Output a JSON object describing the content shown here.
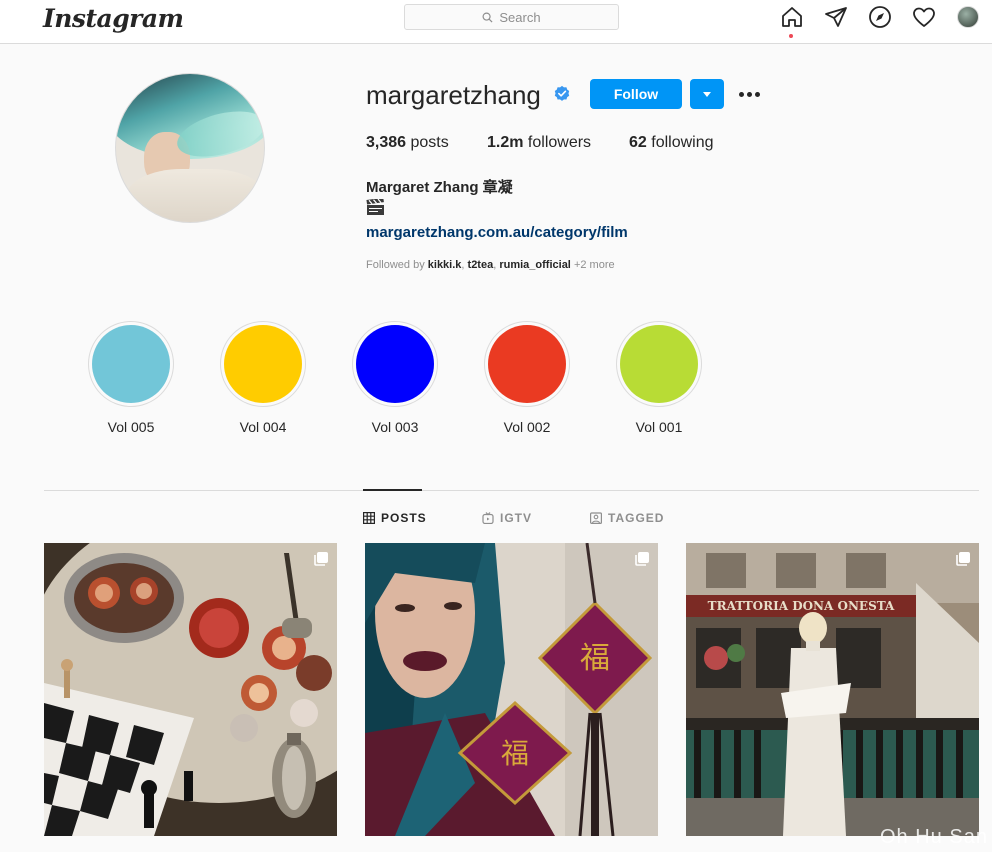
{
  "nav": {
    "logo": "Instagram",
    "search_placeholder": "Search",
    "icons": [
      "home-icon",
      "direct-icon",
      "explore-icon",
      "activity-icon",
      "profile-avatar"
    ]
  },
  "profile": {
    "username": "margaretzhang",
    "verified": true,
    "follow_label": "Follow",
    "stats": {
      "posts_count": "3,386",
      "posts_label": "posts",
      "followers_count": "1.2m",
      "followers_label": "followers",
      "following_count": "62",
      "following_label": "following"
    },
    "full_name": "Margaret Zhang 章凝",
    "bio_emoji": "clapper-board-icon",
    "website": "margaretzhang.com.au/category/film",
    "followed_by": {
      "prefix": "Followed by",
      "users": [
        "kikki.k",
        "t2tea",
        "rumia_official"
      ],
      "more": "+2 more"
    }
  },
  "highlights": [
    {
      "label": "Vol 005",
      "color": "#72c6d8"
    },
    {
      "label": "Vol 004",
      "color": "#ffcc00"
    },
    {
      "label": "Vol 003",
      "color": "#0000ff"
    },
    {
      "label": "Vol 002",
      "color": "#ea3a22"
    },
    {
      "label": "Vol 001",
      "color": "#b8dc35"
    }
  ],
  "tabs": [
    {
      "label": "POSTS",
      "icon": "grid-icon",
      "active": true
    },
    {
      "label": "IGTV",
      "icon": "igtv-icon",
      "active": false
    },
    {
      "label": "TAGGED",
      "icon": "tagged-icon",
      "active": false
    }
  ],
  "posts": [
    {
      "type": "carousel",
      "description_icon": "multiple-photos-icon"
    },
    {
      "type": "carousel",
      "description_icon": "multiple-photos-icon"
    },
    {
      "type": "carousel",
      "description_icon": "multiple-photos-icon",
      "sign_text": "TRATTORIA DONA ONESTA"
    }
  ],
  "colors": {
    "accent": "#0095f6",
    "link": "#00376b",
    "notification_dot": "#ed4956"
  },
  "watermark": "Oh Hu San"
}
